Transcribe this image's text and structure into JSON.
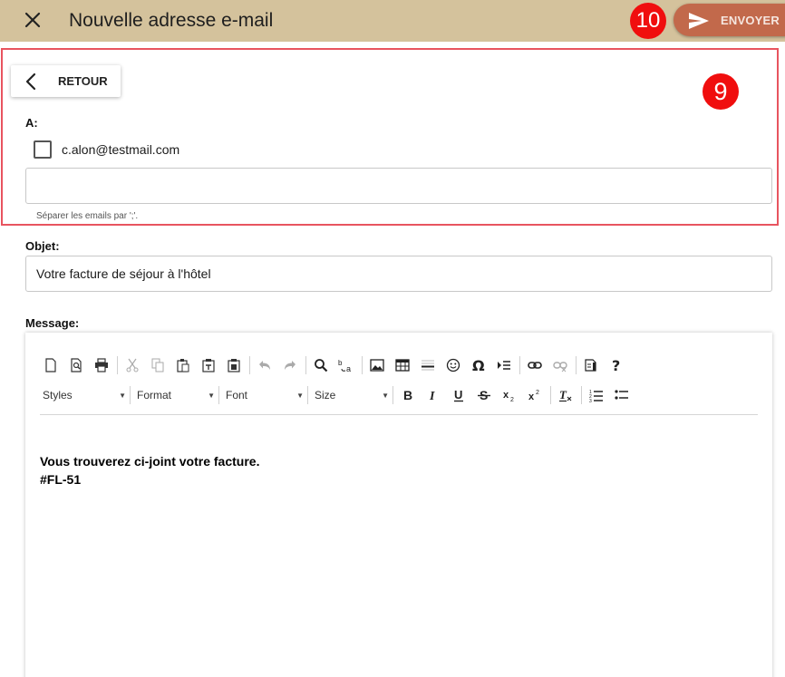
{
  "header": {
    "title": "Nouvelle adresse e-mail",
    "send_label": "ENVOYER",
    "badge_send": "10"
  },
  "recipients": {
    "back_label": "RETOUR",
    "to_label": "A:",
    "contact": "c.alon@testmail.com",
    "contact_checked": false,
    "extra_value": "",
    "hint": "Séparer les emails par ';'.",
    "badge": "9"
  },
  "subject": {
    "label": "Objet:",
    "value": "Votre facture de séjour à l'hôtel"
  },
  "message": {
    "label": "Message:",
    "toolbar": {
      "styles": "Styles",
      "format": "Format",
      "font": "Font",
      "size": "Size"
    },
    "body_line1": "Vous trouverez ci-joint votre facture.",
    "body_line2": "#FL-51"
  },
  "colors": {
    "header_bg": "#d4c29c",
    "send_button": "#c2694b",
    "badge": "#f00e0e",
    "highlight_border": "#e8545f"
  }
}
